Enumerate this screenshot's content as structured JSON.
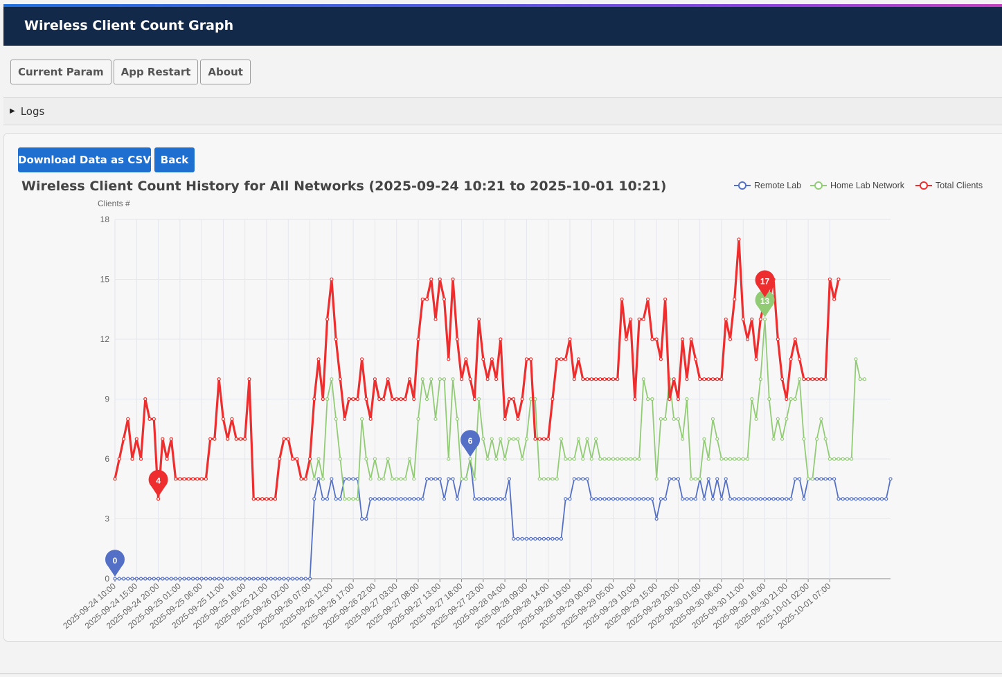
{
  "header": {
    "title": "Wireless Client Count Graph"
  },
  "nav": {
    "items": [
      "Current Param",
      "App Restart",
      "About"
    ]
  },
  "logs": {
    "label": "Logs"
  },
  "actions": {
    "download_label": "Download Data as CSV",
    "back_label": "Back"
  },
  "colors": {
    "header_bg": "#12294a",
    "primary_button": "#1f6fd1",
    "remote": "#5470c6",
    "home": "#91cc75",
    "total": "#ee2e2e"
  },
  "chart_data": {
    "type": "line",
    "title": "Wireless Client Count History for All Networks (2025-09-24 10:21 to 2025-10-01 10:21)",
    "ylabel": "Clients #",
    "ylim": [
      0,
      18
    ],
    "yticks": [
      "0",
      "3",
      "6",
      "9",
      "12",
      "15",
      "18"
    ],
    "grid": true,
    "legend_position": "top-right",
    "x_start": "2025-09-24 10:00",
    "x_interval": "1 hour",
    "xtick_labels": [
      "2025-09-24 10:00",
      "2025-09-24 15:00",
      "2025-09-24 20:00",
      "2025-09-25 01:00",
      "2025-09-25 06:00",
      "2025-09-25 11:00",
      "2025-09-25 16:00",
      "2025-09-25 21:00",
      "2025-09-26 02:00",
      "2025-09-26 07:00",
      "2025-09-26 12:00",
      "2025-09-26 17:00",
      "2025-09-26 22:00",
      "2025-09-27 03:00",
      "2025-09-27 08:00",
      "2025-09-27 13:00",
      "2025-09-27 18:00",
      "2025-09-27 23:00",
      "2025-09-28 04:00",
      "2025-09-28 09:00",
      "2025-09-28 14:00",
      "2025-09-28 19:00",
      "2025-09-29 00:00",
      "2025-09-29 05:00",
      "2025-09-29 10:00",
      "2025-09-29 15:00",
      "2025-09-29 20:00",
      "2025-09-30 01:00",
      "2025-09-30 06:00",
      "2025-09-30 11:00",
      "2025-09-30 16:00",
      "2025-09-30 21:00",
      "2025-10-01 02:00",
      "2025-10-01 07:00"
    ],
    "series": [
      {
        "name": "Remote Lab",
        "color": "#5470c6",
        "marker_labels": [
          "0",
          "6"
        ],
        "values": [
          0,
          0,
          0,
          0,
          0,
          0,
          0,
          0,
          0,
          0,
          0,
          0,
          0,
          0,
          0,
          0,
          0,
          0,
          0,
          0,
          0,
          0,
          0,
          0,
          0,
          0,
          0,
          0,
          0,
          0,
          0,
          0,
          0,
          0,
          0,
          0,
          0,
          0,
          0,
          0,
          0,
          0,
          0,
          0,
          0,
          0,
          4,
          5,
          4,
          4,
          5,
          4,
          4,
          5,
          5,
          5,
          5,
          3,
          3,
          4,
          4,
          4,
          4,
          4,
          4,
          4,
          4,
          4,
          4,
          4,
          4,
          4,
          5,
          5,
          5,
          5,
          4,
          5,
          5,
          4,
          5,
          5,
          6,
          4,
          4,
          4,
          4,
          4,
          4,
          4,
          4,
          5,
          2,
          2,
          2,
          2,
          2,
          2,
          2,
          2,
          2,
          2,
          2,
          2,
          4,
          4,
          5,
          5,
          5,
          5,
          4,
          4,
          4,
          4,
          4,
          4,
          4,
          4,
          4,
          4,
          4,
          4,
          4,
          4,
          4,
          3,
          4,
          4,
          5,
          5,
          5,
          4,
          4,
          4,
          4,
          5,
          4,
          5,
          4,
          5,
          4,
          5,
          4,
          4,
          4,
          4,
          4,
          4,
          4,
          4,
          4,
          4,
          4,
          4,
          4,
          4,
          4,
          5,
          5,
          4,
          5,
          5,
          5,
          5,
          5,
          5,
          5,
          4,
          4,
          4,
          4,
          4,
          4,
          4,
          4,
          4,
          4,
          4,
          4,
          5
        ]
      },
      {
        "name": "Home Lab Network",
        "color": "#91cc75",
        "marker_labels": [
          "13"
        ],
        "values": [
          5,
          6,
          7,
          8,
          6,
          7,
          6,
          9,
          8,
          8,
          4,
          7,
          6,
          7,
          5,
          5,
          5,
          5,
          5,
          5,
          5,
          5,
          7,
          7,
          10,
          8,
          7,
          8,
          7,
          7,
          7,
          10,
          4,
          4,
          4,
          4,
          4,
          4,
          6,
          7,
          7,
          6,
          6,
          5,
          5,
          6,
          5,
          6,
          5,
          9,
          10,
          8,
          6,
          4,
          4,
          4,
          4,
          8,
          6,
          5,
          6,
          5,
          5,
          6,
          5,
          5,
          5,
          5,
          6,
          5,
          8,
          10,
          9,
          10,
          8,
          10,
          10,
          6,
          10,
          8,
          5,
          5,
          6,
          5,
          9,
          7,
          6,
          7,
          6,
          7,
          6,
          7,
          7,
          7,
          6,
          7,
          9,
          9,
          5,
          5,
          5,
          5,
          5,
          7,
          6,
          6,
          6,
          7,
          6,
          7,
          6,
          7,
          6,
          6,
          6,
          6,
          6,
          6,
          6,
          6,
          6,
          6,
          10,
          9,
          9,
          5,
          8,
          8,
          10,
          8,
          8,
          7,
          9,
          5,
          5,
          5,
          7,
          6,
          8,
          7,
          6,
          6,
          6,
          6,
          6,
          6,
          6,
          9,
          8,
          10,
          13,
          9,
          7,
          8,
          7,
          8,
          9,
          9,
          10,
          7,
          5,
          5,
          7,
          8,
          7,
          6,
          6,
          6,
          6,
          6,
          6,
          11,
          10,
          10
        ]
      },
      {
        "name": "Total Clients",
        "color": "#ee2e2e",
        "marker_labels": [
          "4",
          "17"
        ],
        "values": [
          5,
          6,
          7,
          8,
          6,
          7,
          6,
          9,
          8,
          8,
          4,
          7,
          6,
          7,
          5,
          5,
          5,
          5,
          5,
          5,
          5,
          5,
          7,
          7,
          10,
          8,
          7,
          8,
          7,
          7,
          7,
          10,
          4,
          4,
          4,
          4,
          4,
          4,
          6,
          7,
          7,
          6,
          6,
          5,
          5,
          6,
          9,
          11,
          9,
          13,
          15,
          12,
          10,
          8,
          9,
          9,
          9,
          11,
          9,
          8,
          10,
          9,
          9,
          10,
          9,
          9,
          9,
          9,
          10,
          9,
          12,
          14,
          14,
          15,
          13,
          15,
          14,
          11,
          15,
          12,
          10,
          11,
          10,
          9,
          13,
          11,
          10,
          11,
          10,
          12,
          8,
          9,
          9,
          8,
          9,
          11,
          11,
          7,
          7,
          7,
          7,
          9,
          11,
          11,
          11,
          12,
          10,
          11,
          10,
          10,
          10,
          10,
          10,
          10,
          10,
          10,
          10,
          14,
          12,
          13,
          9,
          13,
          13,
          14,
          12,
          12,
          11,
          14,
          9,
          10,
          9,
          12,
          10,
          12,
          11,
          10,
          10,
          10,
          10,
          10,
          10,
          13,
          12,
          14,
          17,
          13,
          12,
          13,
          11,
          13,
          14,
          14,
          15,
          12,
          10,
          9,
          11,
          12,
          11,
          10,
          10,
          10,
          10,
          10,
          10,
          15,
          14,
          15
        ]
      }
    ]
  }
}
